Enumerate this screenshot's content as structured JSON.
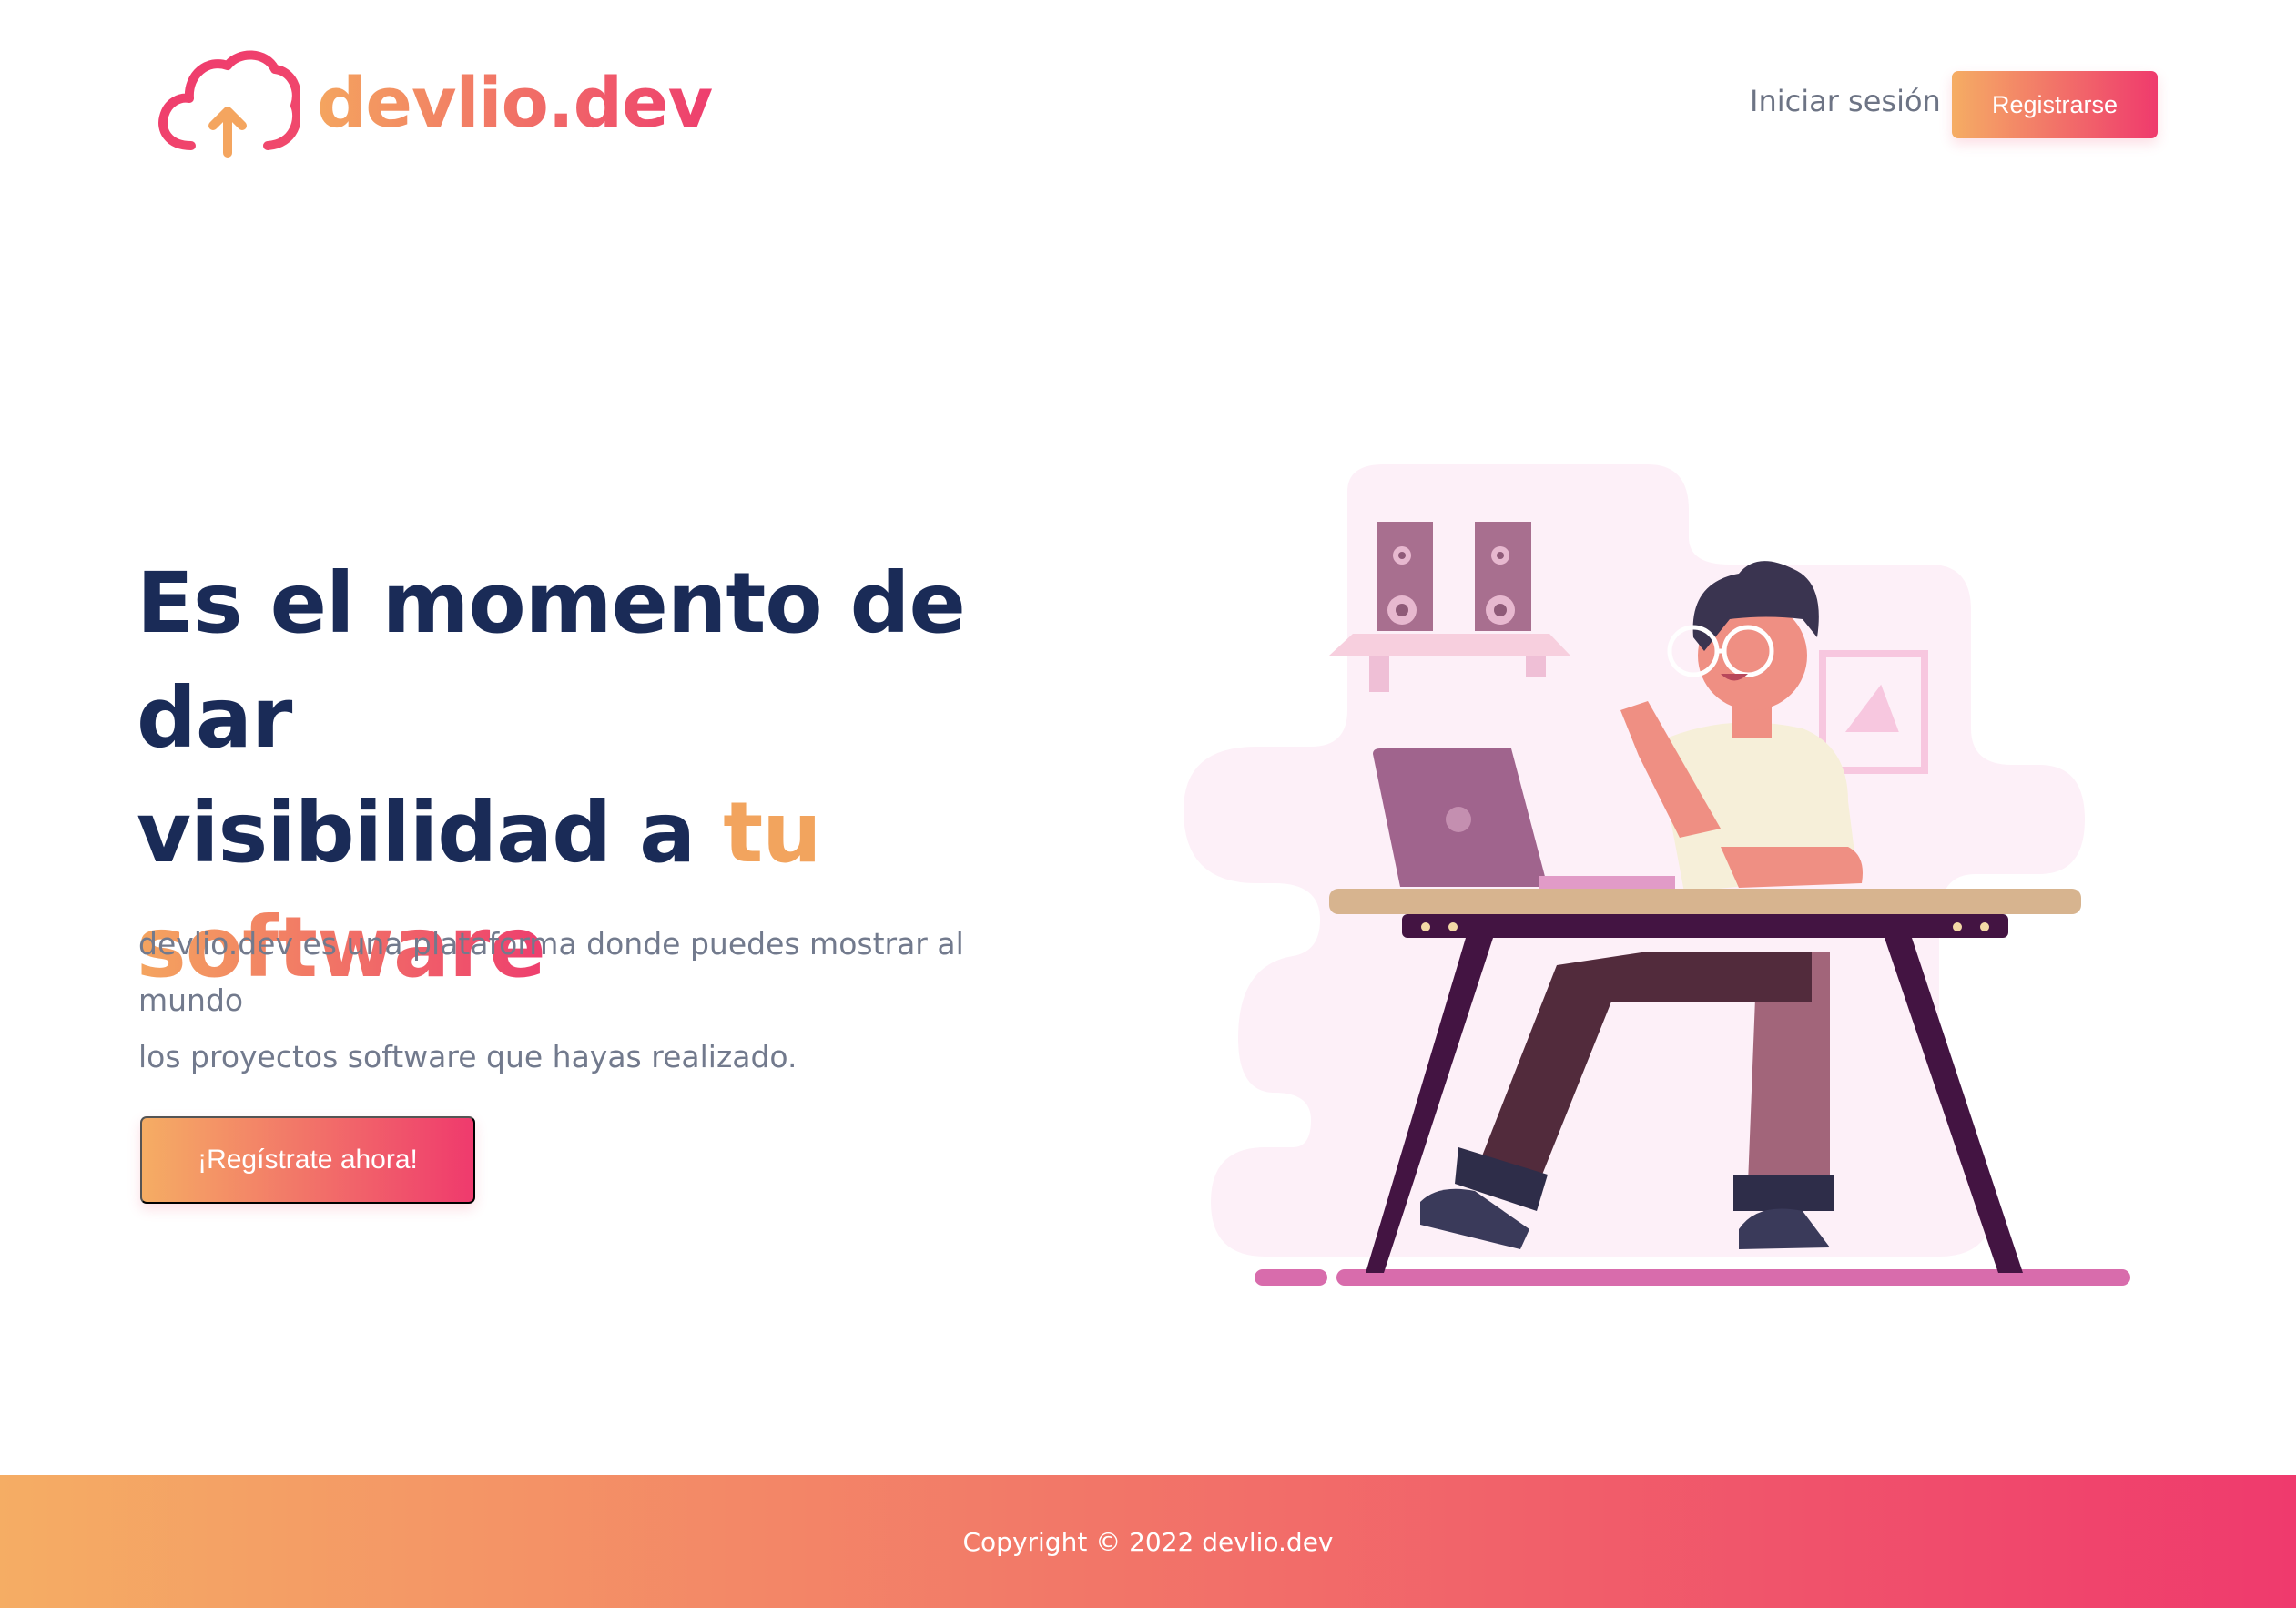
{
  "header": {
    "brand": "devlio.dev",
    "login_label": "Iniciar sesión",
    "register_label": "Registrarse"
  },
  "hero": {
    "title_line1": "Es el momento de dar",
    "title_line2_prefix": "visibilidad a",
    "title_highlight_1": "tu",
    "title_highlight_2": "software",
    "description_line1": "devlio.dev es una plataforma donde puedes mostrar al mundo",
    "description_line2": "los proyectos software que hayas realizado.",
    "cta_label": "¡Regístrate ahora!"
  },
  "footer": {
    "copyright": "Copyright © 2022 devlio.dev"
  },
  "colors": {
    "gradient_start": "#f5ad64",
    "gradient_end": "#ef3a6d",
    "heading": "#1a2b57",
    "body_text": "#727a8d"
  },
  "icons": {
    "logo": "cloud-upload-icon"
  }
}
